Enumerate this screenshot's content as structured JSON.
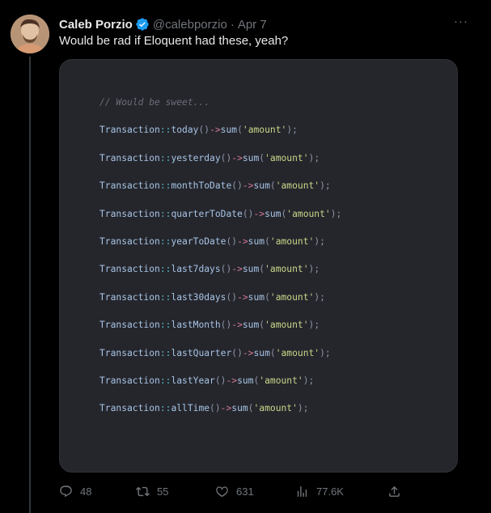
{
  "author": {
    "name": "Caleb Porzio",
    "handle": "@calebporzio",
    "separator": "·",
    "date": "Apr 7",
    "verified_color": "#1d9bf0"
  },
  "tweet": {
    "text": "Would be rad if Eloquent had these, yeah?"
  },
  "more_label": "···",
  "code": {
    "comment": "// Would be sweet...",
    "class_name": "Transaction",
    "scope_op": "::",
    "call_parens": "()",
    "arrow": "->",
    "sum_method": "sum",
    "arg": "'amount'",
    "end": ");",
    "methods": [
      "today",
      "yesterday",
      "monthToDate",
      "quarterToDate",
      "yearToDate",
      "last7days",
      "last30days",
      "lastMonth",
      "lastQuarter",
      "lastYear",
      "allTime"
    ]
  },
  "actions": {
    "replies": "48",
    "retweets": "55",
    "likes": "631",
    "views": "77.6K"
  },
  "icons": {
    "reply": "reply-icon",
    "retweet": "retweet-icon",
    "like": "heart-icon",
    "views": "analytics-icon",
    "share": "share-icon"
  },
  "colors": {
    "background": "#000000",
    "text_primary": "#e7e9ea",
    "text_secondary": "#71767b",
    "code_background": "#25262c",
    "accent": "#1d9bf0"
  }
}
